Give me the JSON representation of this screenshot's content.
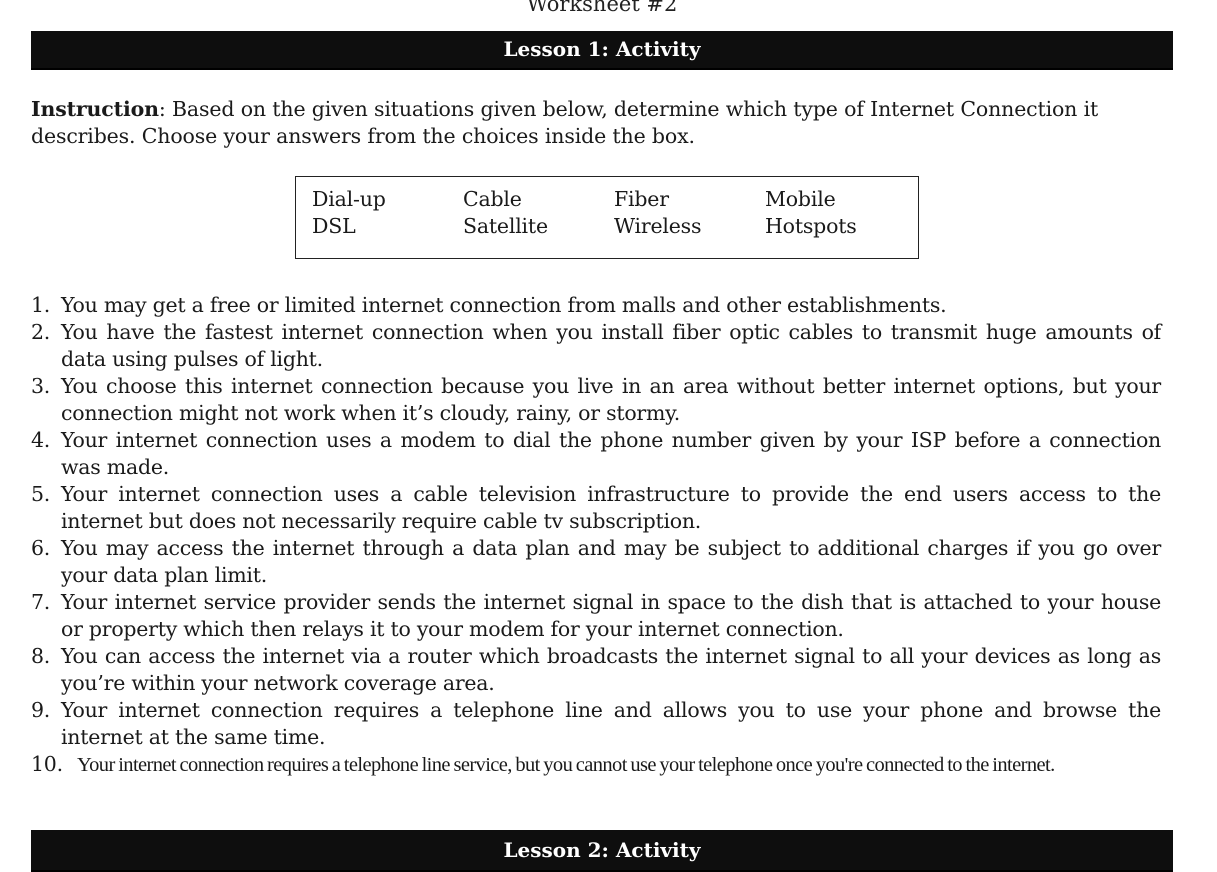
{
  "worksheet_title": "Worksheet #2",
  "lesson1": {
    "header": "Lesson 1: Activity",
    "instruction_label": "Instruction",
    "instruction_text": ": Based on the given situations given below, determine which type of Internet Connection it describes. Choose your answers from the choices inside the box.",
    "choices": [
      "Dial-up",
      "Cable",
      "Fiber",
      "Mobile",
      "DSL",
      "Satellite",
      "Wireless",
      "Hotspots"
    ],
    "questions": [
      {
        "num": "1.",
        "text": "You may get a free or limited internet connection from malls and other establishments."
      },
      {
        "num": "2.",
        "text": "You have the fastest internet connection when you install fiber optic cables to transmit huge amounts of data using pulses of light."
      },
      {
        "num": "3.",
        "text": "You choose this internet connection because you live in an area without better internet options, but your connection might not work when it’s cloudy, rainy, or stormy."
      },
      {
        "num": "4.",
        "text": "Your internet connection uses a modem to dial the phone number given by your ISP before a connection was made."
      },
      {
        "num": "5.",
        "text": "Your internet connection uses a cable television infrastructure to provide the end users access to the internet but does not necessarily require cable tv subscription."
      },
      {
        "num": "6.",
        "text": "You may access the internet through a data plan and may be subject to additional charges if you go over your data plan limit."
      },
      {
        "num": "7.",
        "text": "Your internet service provider sends the internet signal in space to the dish that is attached to your house or property which then relays it to your modem for your internet connection."
      },
      {
        "num": "8.",
        "text": "You can access the internet via a router which broadcasts the internet signal to all your devices as long as you’re within your network coverage area."
      },
      {
        "num": "9.",
        "text": "Your internet connection requires a telephone line and allows you to use your phone and browse the internet at the same time."
      },
      {
        "num": "10.",
        "text": "Your internet connection requires a telephone line service, but you cannot use your telephone once you're connected to the internet."
      }
    ]
  },
  "lesson2": {
    "header": "Lesson 2: Activity"
  }
}
